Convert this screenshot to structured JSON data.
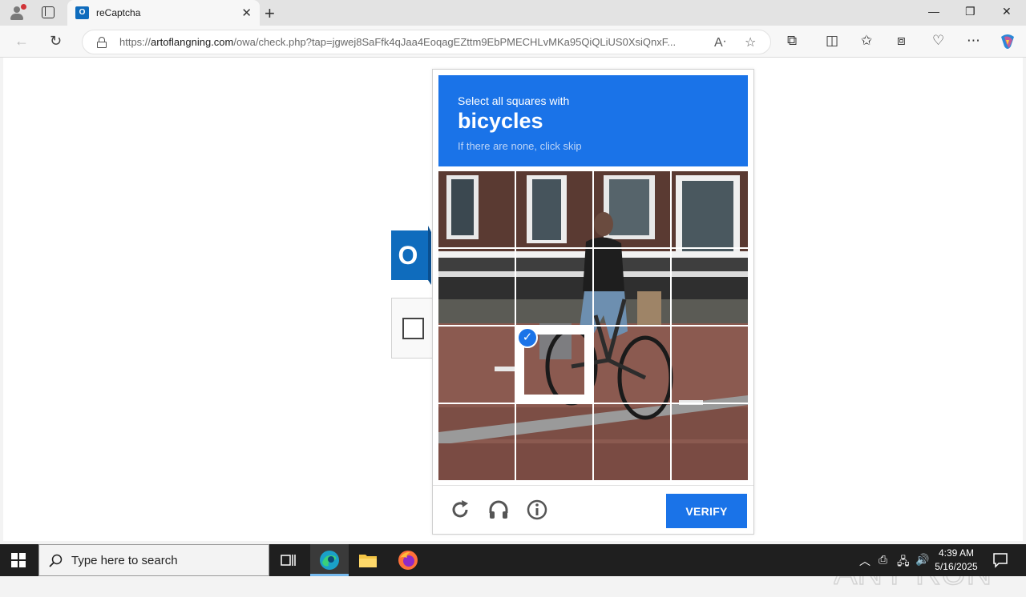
{
  "browser": {
    "tab_title": "reCaptcha",
    "tab_icon_letter": "O",
    "url_domain": "artoflangning.com",
    "url_prefix": "https://",
    "url_path": "/owa/check.php?tap=jgwej8SaFfk4qJaa4EoqagEZttm9EbPMECHLvMKa95QiQLiUS0XsiQnxF..."
  },
  "page": {
    "outlook_logo_letter": "O",
    "captcha": {
      "instruction": "Select all squares with",
      "target_word": "bicycles",
      "hint": "If there are none, click skip",
      "verify_label": "VERIFY",
      "selected_tiles": [
        5
      ],
      "accent_color": "#1a73e8"
    },
    "watermark_text": "ANY RUN"
  },
  "taskbar": {
    "search_placeholder": "Type here to search",
    "time": "4:39 AM",
    "date": "5/16/2025"
  }
}
